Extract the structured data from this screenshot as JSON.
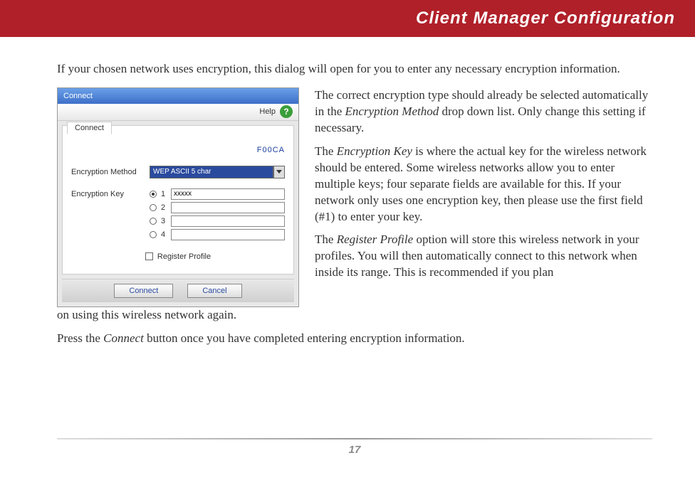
{
  "header": {
    "title": "Client Manager Configuration"
  },
  "intro": "If your chosen network uses encryption, this dialog will open for you to enter any necessary encryption information.",
  "dialog": {
    "title": "Connect",
    "help_label": "Help",
    "tab": "Connect",
    "ssid": "F00CA",
    "enc_method_label": "Encryption Method",
    "enc_method_value": "WEP ASCII 5 char",
    "enc_key_label": "Encryption Key",
    "keys": [
      {
        "n": "1",
        "v": "xxxxx",
        "sel": true
      },
      {
        "n": "2",
        "v": "",
        "sel": false
      },
      {
        "n": "3",
        "v": "",
        "sel": false
      },
      {
        "n": "4",
        "v": "",
        "sel": false
      }
    ],
    "register_label": "Register Profile",
    "connect_btn": "Connect",
    "cancel_btn": "Cancel"
  },
  "body": {
    "p1a": "The correct encryption type should already be selected automatically in the ",
    "p1i": "Encryption Method",
    "p1b": " drop down list.  Only change this setting if necessary.",
    "p2a": "The ",
    "p2i": "Encryption Key",
    "p2b": " is where the actual key for the wireless network should be entered.  Some wireless networks allow you to enter multiple keys; four separate fields are available for this.  If your network only uses one encryption key, then please use the first field (#1) to enter your key.",
    "p3a": "The ",
    "p3i": "Register Profile",
    "p3b": " option will store this wireless network in your profiles.  You will then automatically connect to this network when inside its range.  This is recommended if you plan ",
    "p3c": "on using this wireless network again.",
    "p4a": "Press the ",
    "p4i": "Connect",
    "p4b": " button once you have completed entering encryption information."
  },
  "page_number": "17"
}
